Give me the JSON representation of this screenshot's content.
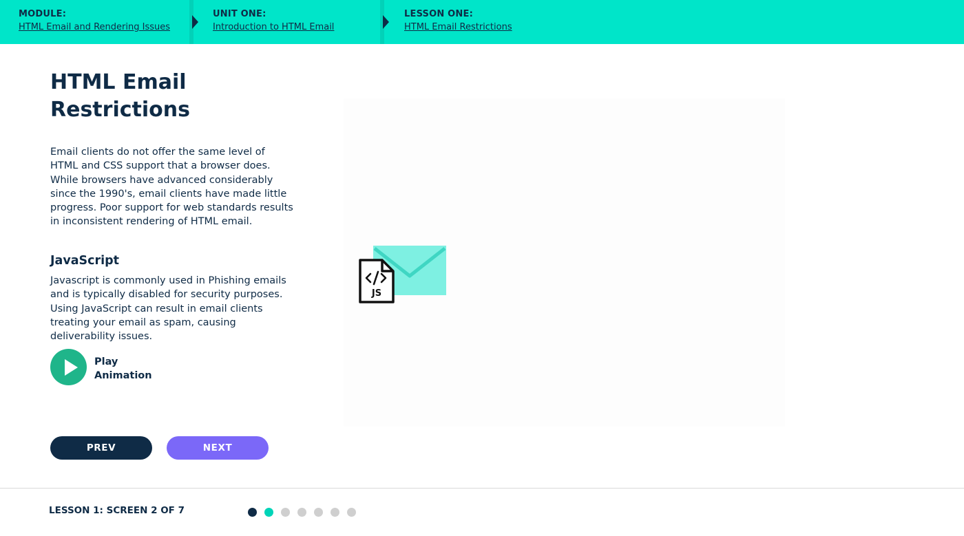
{
  "breadcrumbs": [
    {
      "label": "MODULE:",
      "link": "HTML Email and Rendering Issues"
    },
    {
      "label": "UNIT ONE:",
      "link": "Introduction to HTML Email"
    },
    {
      "label": "LESSON ONE:",
      "link": "HTML Email Restrictions"
    }
  ],
  "content": {
    "title": "HTML Email Restrictions",
    "intro": "Email clients do not offer the same level of HTML and CSS support that a browser does. While browsers have advanced considerably since the 1990's, email clients have made little progress. Poor support for web standards results in inconsistent rendering of HTML email.",
    "section_heading": "JavaScript",
    "section_text": "Javascript is commonly used in Phishing emails and is typically disabled for security purposes. Using JavaScript can result in email clients treating your email as spam, causing deliverability issues.",
    "play_label": "Play Animation"
  },
  "stage": {
    "file_icon_text": "JS",
    "icons": [
      "envelope-icon",
      "js-file-icon",
      "code-tag-icon"
    ]
  },
  "nav": {
    "prev_label": "PREV",
    "next_label": "NEXT"
  },
  "footer": {
    "progress_label": "LESSON 1: SCREEN 2 OF 7",
    "current_screen": 2,
    "total_screens": 7
  },
  "colors": {
    "accent": "#00e5c9",
    "navy": "#0f2b46",
    "next_button": "#7b68f8",
    "play_green": "#1fb58a",
    "dot_done": "#0f2b46",
    "dot_current": "#00d4b8",
    "dot_pending": "#cfcfcf"
  }
}
